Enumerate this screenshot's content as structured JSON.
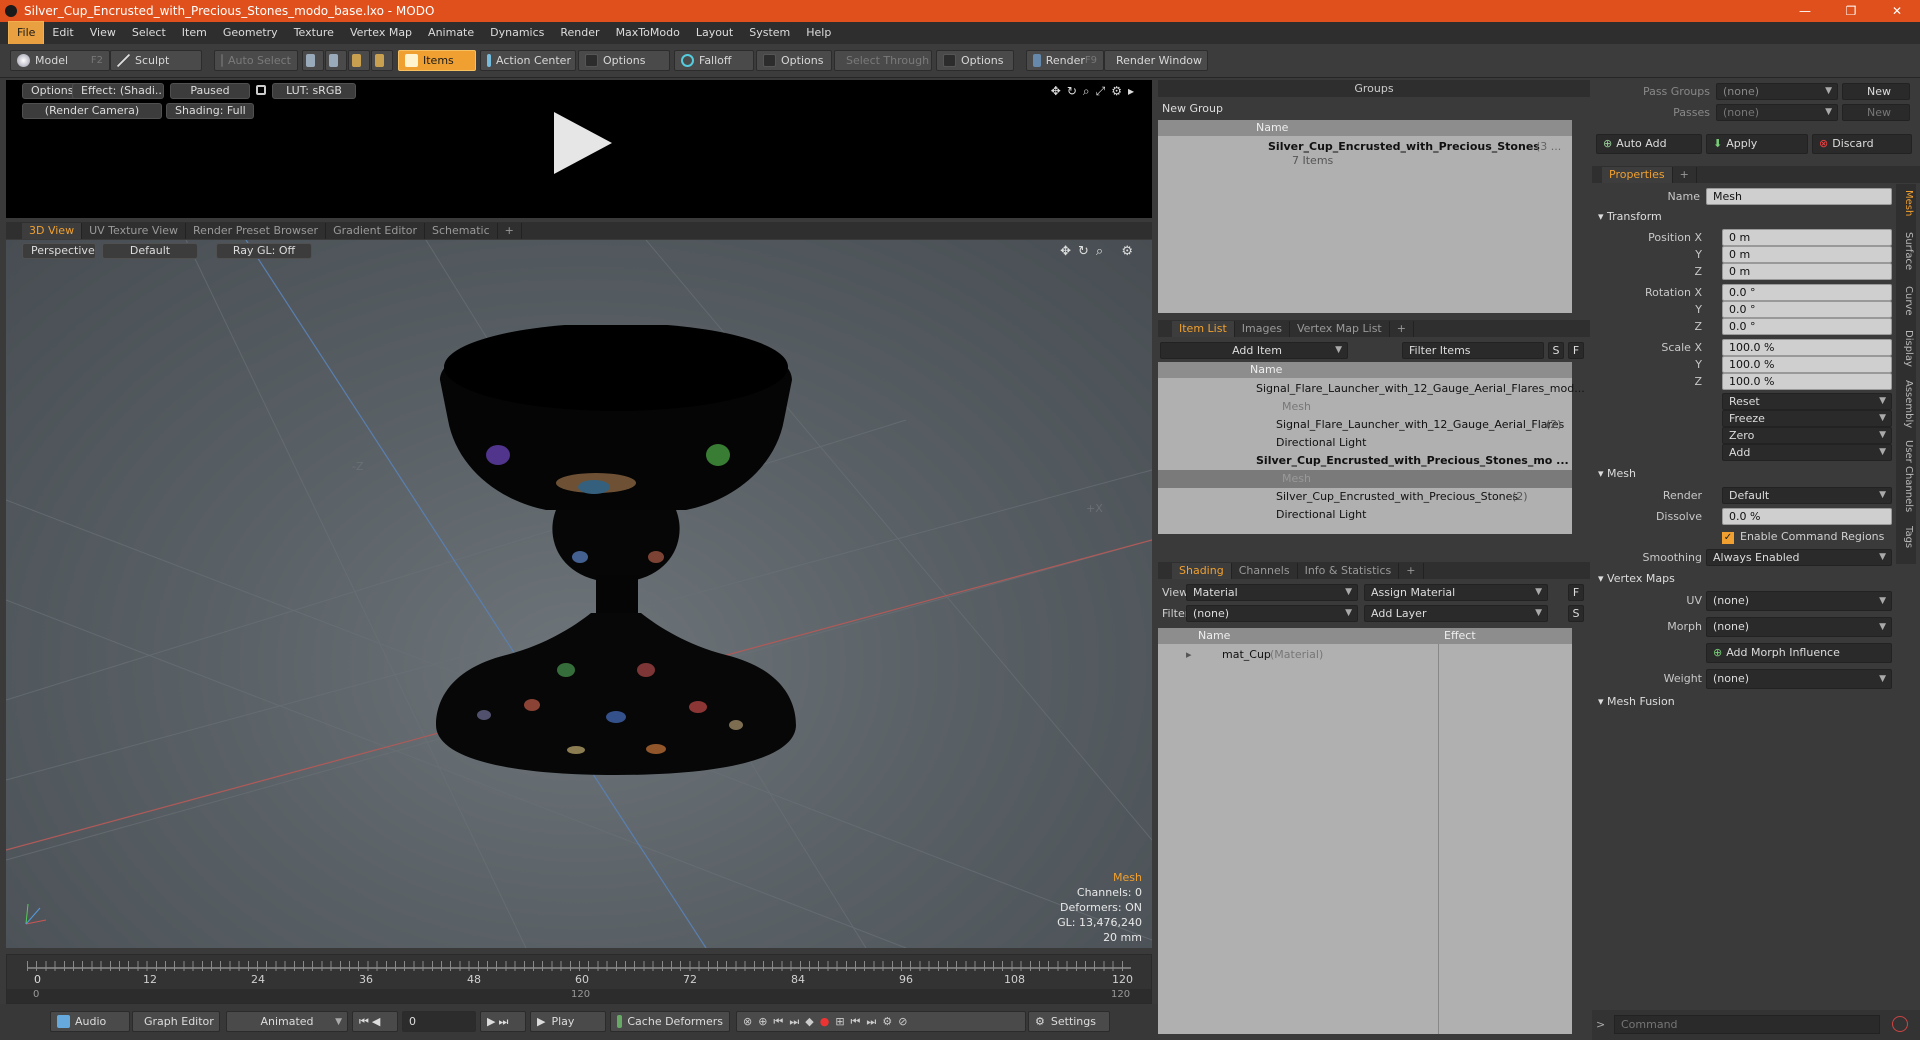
{
  "window": {
    "title": "Silver_Cup_Encrusted_with_Precious_Stones_modo_base.lxo - MODO",
    "min": "—",
    "max": "❐",
    "close": "✕"
  },
  "menu": [
    "File",
    "Edit",
    "View",
    "Select",
    "Item",
    "Geometry",
    "Texture",
    "Vertex Map",
    "Animate",
    "Dynamics",
    "Render",
    "MaxToModo",
    "Layout",
    "System",
    "Help"
  ],
  "toolbar": {
    "model": "Model",
    "model_key": "F2",
    "sculpt": "Sculpt",
    "auto_select": "Auto Select",
    "items": "Items",
    "action_center": "Action Center",
    "options1": "Options",
    "falloff": "Falloff",
    "options2": "Options",
    "select_through": "Select Through",
    "options3": "Options",
    "render": "Render",
    "render_key": "F9",
    "render_window": "Render Window"
  },
  "preview": {
    "options": "Options",
    "effect": "Effect: (Shadi...",
    "paused": "Paused",
    "lut": "LUT: sRGB",
    "camera": "(Render Camera)",
    "shading": "Shading: Full"
  },
  "viewport_tabs": [
    "3D View",
    "UV Texture View",
    "Render Preset Browser",
    "Gradient Editor",
    "Schematic",
    "+"
  ],
  "viewport": {
    "perspective": "Perspective",
    "default": "Default",
    "raygl": "Ray GL: Off",
    "axis_neg_z": "-Z",
    "axis_pos_x": "+X",
    "info": {
      "selected": "Mesh",
      "channels": "Channels: 0",
      "deformers": "Deformers: ON",
      "gl": "GL: 13,476,240",
      "unit": "20 mm"
    }
  },
  "timeline": {
    "ticks": [
      "0",
      "12",
      "24",
      "36",
      "48",
      "60",
      "72",
      "84",
      "96",
      "108",
      "120"
    ],
    "sub_left": "0",
    "sub_mid": "120",
    "sub_right": "120"
  },
  "bottombar": {
    "audio": "Audio",
    "graph_editor": "Graph Editor",
    "animated": "Animated",
    "frame": "0",
    "play": "Play",
    "cache": "Cache Deformers",
    "settings": "Settings"
  },
  "groups": {
    "title": "Groups",
    "new_group": "New Group",
    "col_name": "Name",
    "item_name": "Silver_Cup_Encrusted_with_Precious_Stones",
    "item_count": "(3 ...",
    "item_sub": "7 Items"
  },
  "itemlist": {
    "tabs": [
      "Item List",
      "Images",
      "Vertex Map List",
      "+"
    ],
    "add_item": "Add Item",
    "filter": "Filter Items",
    "s": "S",
    "f": "F",
    "col_name": "Name",
    "rows": [
      {
        "text": "Signal_Flare_Launcher_with_12_Gauge_Aerial_Flares_mod...",
        "extra": "",
        "indent": 0,
        "bold": false,
        "type": "scene"
      },
      {
        "text": "Mesh",
        "extra": "",
        "indent": 2,
        "bold": false,
        "type": "mesh-dim"
      },
      {
        "text": "Signal_Flare_Launcher_with_12_Gauge_Aerial_Flares",
        "extra": "(2)",
        "indent": 1,
        "bold": false,
        "type": "group"
      },
      {
        "text": "Directional Light",
        "extra": "",
        "indent": 1,
        "bold": false,
        "type": "light"
      },
      {
        "text": "Silver_Cup_Encrusted_with_Precious_Stones_mo ...",
        "extra": "",
        "indent": 0,
        "bold": true,
        "type": "scene"
      },
      {
        "text": "Mesh",
        "extra": "",
        "indent": 2,
        "bold": false,
        "type": "mesh-sel"
      },
      {
        "text": "Silver_Cup_Encrusted_with_Precious_Stones",
        "extra": "(2)",
        "indent": 1,
        "bold": false,
        "type": "group"
      },
      {
        "text": "Directional Light",
        "extra": "",
        "indent": 1,
        "bold": false,
        "type": "light"
      }
    ]
  },
  "shading": {
    "tabs": [
      "Shading",
      "Channels",
      "Info & Statistics",
      "+"
    ],
    "view_label": "View",
    "view_value": "Material",
    "assign": "Assign Material",
    "f": "F",
    "filter_label": "Filter",
    "filter_value": "(none)",
    "add_layer": "Add Layer",
    "s": "S",
    "col_name": "Name",
    "col_effect": "Effect",
    "mat": "mat_Cup",
    "mat_type": "(Material)"
  },
  "passes": {
    "pass_groups": "Pass Groups",
    "pass_value": "(none)",
    "new1": "New",
    "passes": "Passes",
    "passes_value": "(none)",
    "new2": "New",
    "auto_add": "Auto Add",
    "apply": "Apply",
    "discard": "Discard"
  },
  "properties": {
    "tab": "Properties",
    "plus": "+",
    "name_label": "Name",
    "name_value": "Mesh",
    "transform": "Transform",
    "pos_x_label": "Position X",
    "pos_y_label": "Y",
    "pos_z_label": "Z",
    "pos_x": "0 m",
    "pos_y": "0 m",
    "pos_z": "0 m",
    "rot_x_label": "Rotation X",
    "rot_y_label": "Y",
    "rot_z_label": "Z",
    "rot_x": "0.0 °",
    "rot_y": "0.0 °",
    "rot_z": "0.0 °",
    "scl_x_label": "Scale X",
    "scl_y_label": "Y",
    "scl_z_label": "Z",
    "scl_x": "100.0 %",
    "scl_y": "100.0 %",
    "scl_z": "100.0 %",
    "reset": "Reset",
    "freeze": "Freeze",
    "zero": "Zero",
    "add": "Add",
    "mesh": "Mesh",
    "render_label": "Render",
    "render_value": "Default",
    "dissolve_label": "Dissolve",
    "dissolve_value": "0.0 %",
    "enable_cmd": "Enable Command Regions",
    "smoothing_label": "Smoothing",
    "smoothing_value": "Always Enabled",
    "vertex_maps": "Vertex Maps",
    "uv_label": "UV",
    "uv_value": "(none)",
    "morph_label": "Morph",
    "morph_value": "(none)",
    "add_morph": "Add Morph Influence",
    "weight_label": "Weight",
    "weight_value": "(none)",
    "mesh_fusion": "Mesh Fusion",
    "side_tabs": [
      "Mesh",
      "Surface",
      "Curve",
      "Display",
      "Assembly",
      "User Channels",
      "Tags"
    ]
  },
  "command": {
    "placeholder": "Command",
    "arrow": ">"
  }
}
